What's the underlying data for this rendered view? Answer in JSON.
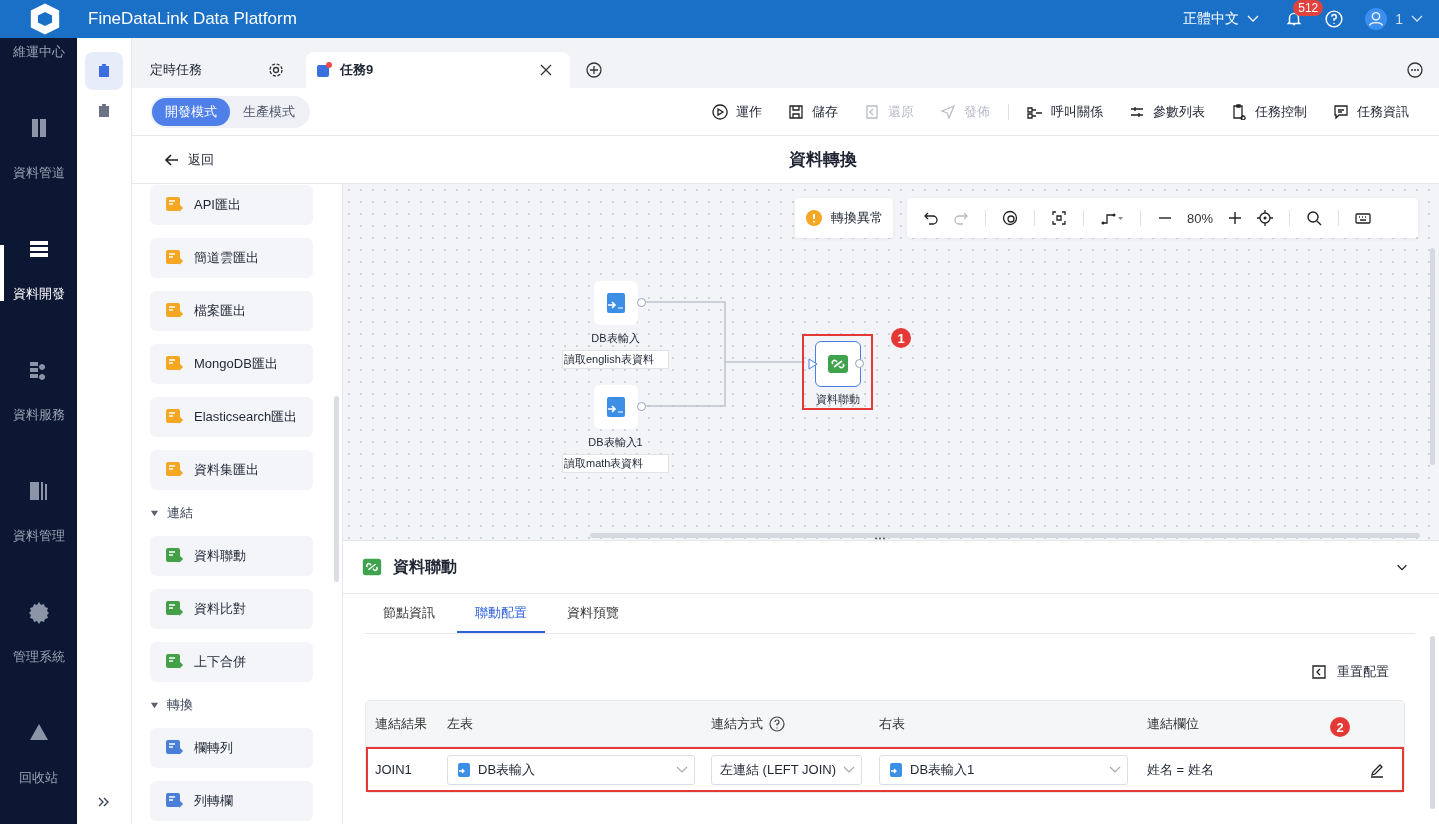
{
  "header": {
    "title": "FineDataLink Data Platform",
    "language": "正體中文",
    "notifications": "512",
    "user": "1"
  },
  "nav": [
    {
      "label": "維運中心",
      "selected": false
    },
    {
      "label": "資料管道",
      "selected": false
    },
    {
      "label": "資料開發",
      "selected": true
    },
    {
      "label": "資料服務",
      "selected": false
    },
    {
      "label": "資料管理",
      "selected": false
    },
    {
      "label": "管理系統",
      "selected": false
    },
    {
      "label": "回收站",
      "selected": false
    }
  ],
  "subnav": [
    {
      "selected": true
    },
    {
      "selected": false
    }
  ],
  "tabs": [
    {
      "label": "定時任務",
      "selected": false
    },
    {
      "label": "任務9",
      "selected": true
    }
  ],
  "modes": [
    {
      "label": "開發模式",
      "selected": true
    },
    {
      "label": "生產模式",
      "selected": false
    }
  ],
  "actions": [
    {
      "label": "運作",
      "disabled": false
    },
    {
      "label": "儲存",
      "disabled": false
    },
    {
      "label": "還原",
      "disabled": true
    },
    {
      "label": "發佈",
      "disabled": true
    },
    {
      "label": "呼叫關係",
      "disabled": false
    },
    {
      "label": "參數列表",
      "disabled": false
    },
    {
      "label": "任務控制",
      "disabled": false
    },
    {
      "label": "任務資訊",
      "disabled": false
    }
  ],
  "back": "返回",
  "page_title": "資料轉換",
  "palette": [
    {
      "kind": "item",
      "label": "API匯出"
    },
    {
      "kind": "item",
      "label": "簡道雲匯出"
    },
    {
      "kind": "item",
      "label": "檔案匯出"
    },
    {
      "kind": "item",
      "label": "MongoDB匯出"
    },
    {
      "kind": "item",
      "label": "Elasticsearch匯出"
    },
    {
      "kind": "item",
      "label": "資料集匯出"
    },
    {
      "kind": "section",
      "label": "連結",
      "expanded": true
    },
    {
      "kind": "item",
      "label": "資料聯動"
    },
    {
      "kind": "item",
      "label": "資料比對"
    },
    {
      "kind": "item",
      "label": "上下合併"
    },
    {
      "kind": "section",
      "label": "轉換",
      "expanded": true
    },
    {
      "kind": "item",
      "label": "欄轉列"
    },
    {
      "kind": "item",
      "label": "列轉欄"
    }
  ],
  "canvas": {
    "status": "轉換異常",
    "zoom": "80%",
    "marker": "1",
    "nodes": [
      {
        "kind": "db",
        "label": "DB表輸入",
        "caption": "讀取english表資料"
      },
      {
        "kind": "db",
        "label": "DB表輸入1",
        "caption": "讀取math表資料"
      },
      {
        "kind": "join",
        "label": "資料聯動",
        "highlighted": true
      }
    ]
  },
  "panel": {
    "title": "資料聯動",
    "tabs": [
      {
        "label": "節點資訊",
        "selected": false
      },
      {
        "label": "聯動配置",
        "selected": true
      },
      {
        "label": "資料預覽",
        "selected": false
      }
    ],
    "reset": "重置配置",
    "marker": "2",
    "columns": [
      "連結結果",
      "左表",
      "連結方式",
      "右表",
      "連結欄位"
    ],
    "rows": [
      {
        "result": "JOIN1",
        "left": "DB表輸入",
        "method": "左連結 (LEFT JOIN)",
        "right": "DB表輸入1",
        "fields": "姓名 = 姓名",
        "highlighted": true
      }
    ]
  }
}
